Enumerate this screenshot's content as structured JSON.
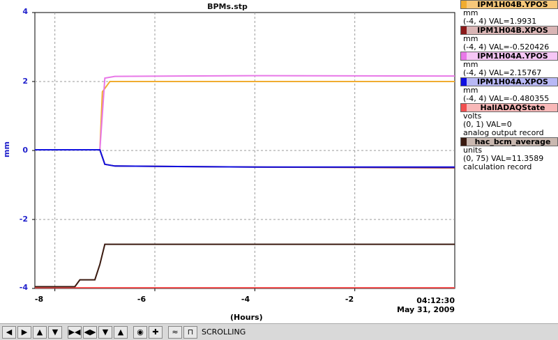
{
  "chart_data": {
    "type": "line",
    "title": "BPMs.stp",
    "ylabel": "mm",
    "xlabel": "(Hours)",
    "ylim": [
      -4,
      4
    ],
    "xlim": [
      -8.4,
      0
    ],
    "yticks": [
      "4",
      "2",
      "0",
      "-2",
      "-4"
    ],
    "xticks": [
      "-8",
      "-6",
      "-4",
      "-2"
    ],
    "grid": true,
    "time_label": "04:12:30",
    "date_label": "May 31, 2009",
    "series": [
      {
        "name": "IPM1H04B.YPOS",
        "color": "#f0ac30",
        "x": [
          -8.4,
          -7.1,
          -7.05,
          -6.9,
          -6.8,
          -6.0,
          0
        ],
        "y": [
          0.02,
          0.02,
          1.7,
          2.0,
          2.0,
          2.0,
          2.0
        ]
      },
      {
        "name": "IPM1H04B.XPOS",
        "color": "#8b1a1a",
        "x": [
          -8.4,
          -7.1,
          -7.0,
          -6.8,
          -4.0,
          0
        ],
        "y": [
          0.02,
          0.02,
          -0.4,
          -0.45,
          -0.48,
          -0.5
        ]
      },
      {
        "name": "IPM1H04A.YPOS",
        "color": "#e878e8",
        "x": [
          -8.4,
          -7.1,
          -7.0,
          -6.8,
          -4.0,
          0
        ],
        "y": [
          0.02,
          0.02,
          2.1,
          2.15,
          2.17,
          2.16
        ]
      },
      {
        "name": "IPM1H04A.XPOS",
        "color": "#1010e0",
        "x": [
          -8.4,
          -7.1,
          -7.0,
          -6.8,
          -4.0,
          0
        ],
        "y": [
          0.02,
          0.02,
          -0.4,
          -0.45,
          -0.48,
          -0.48
        ]
      },
      {
        "name": "HallADAQState",
        "color": "#f05050",
        "x": [
          -8.4,
          0
        ],
        "y": [
          -3.98,
          -3.98
        ]
      },
      {
        "name": "hac_bcm_average",
        "color": "#3a1a10",
        "x": [
          -8.4,
          -7.6,
          -7.5,
          -7.2,
          -7.1,
          -7.0,
          -6.0,
          0
        ],
        "y": [
          -3.95,
          -3.95,
          -3.75,
          -3.75,
          -3.3,
          -2.72,
          -2.72,
          -2.72
        ]
      }
    ]
  },
  "legend": [
    {
      "name": "IPM1H04B.YPOS",
      "color": "#f0ac30",
      "lines": [
        "mm",
        "(-4, 4) VAL=1.9931"
      ]
    },
    {
      "name": "IPM1H04B.XPOS",
      "color": "#8b1a1a",
      "lines": [
        "mm",
        "(-4, 4) VAL=-0.520426"
      ]
    },
    {
      "name": "IPM1H04A.YPOS",
      "color": "#e878e8",
      "lines": [
        "mm",
        "(-4, 4) VAL=2.15767"
      ]
    },
    {
      "name": "IPM1H04A.XPOS",
      "color": "#1010e0",
      "lines": [
        "mm",
        "(-4, 4) VAL=-0.480355"
      ]
    },
    {
      "name": "HallADAQState",
      "color": "#f05050",
      "lines": [
        "volts",
        "(0, 1) VAL=0",
        "analog output record"
      ]
    },
    {
      "name": "hac_bcm_average",
      "color": "#3a1a10",
      "lines": [
        "units",
        "(0, 75) VAL=11.3589",
        "calculation record"
      ]
    }
  ],
  "toolbar": {
    "status": "SCROLLING",
    "buttons": [
      "left-arrow-icon",
      "right-arrow-icon",
      "up-arrow-icon",
      "down-arrow-icon",
      "zoom-in-horizontal-icon",
      "zoom-out-horizontal-icon",
      "zoom-in-vertical-icon",
      "zoom-out-vertical-icon",
      "zoom-center-icon",
      "add-icon",
      "auto-scale-icon",
      "stair-icon"
    ]
  }
}
